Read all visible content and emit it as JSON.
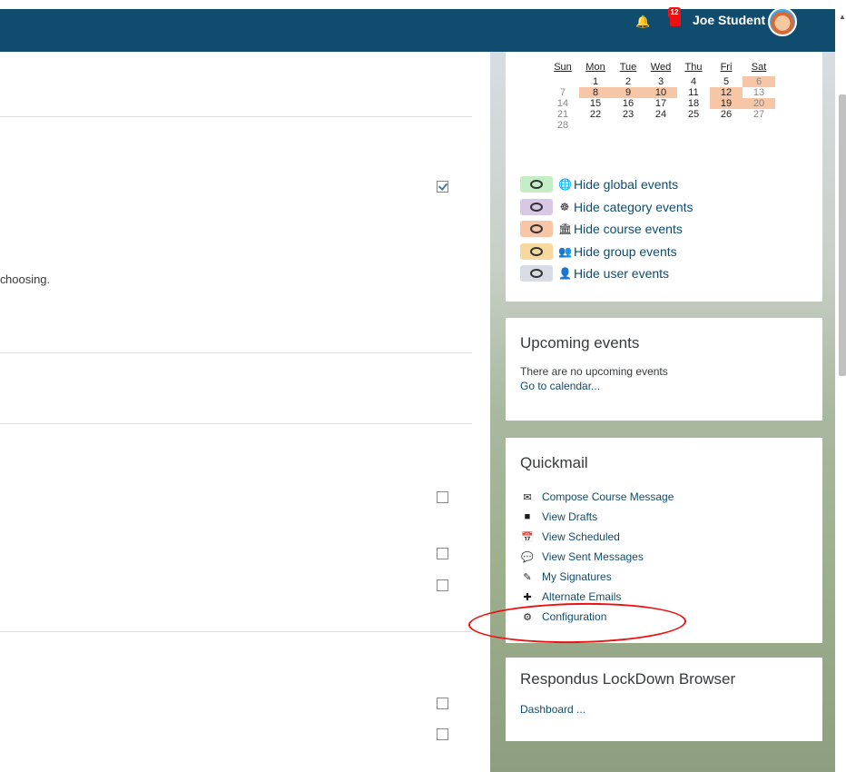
{
  "header": {
    "notification_count": "12",
    "user_name": "Joe Student"
  },
  "main": {
    "fragment_text": "hoosing."
  },
  "calendar": {
    "day_headers": [
      "Sun",
      "Mon",
      "Tue",
      "Wed",
      "Thu",
      "Fri",
      "Sat"
    ],
    "weeks": [
      [
        "",
        "1",
        "2",
        "3",
        "4",
        "5",
        "6"
      ],
      [
        "7",
        "8",
        "9",
        "10",
        "11",
        "12",
        "13"
      ],
      [
        "14",
        "15",
        "16",
        "17",
        "18",
        "19",
        "20"
      ],
      [
        "21",
        "22",
        "23",
        "24",
        "25",
        "26",
        "27"
      ],
      [
        "28",
        "",
        "",
        "",
        "",
        "",
        ""
      ]
    ],
    "legend": [
      {
        "label": "Hide global events",
        "icon": "globe-icon",
        "color": "#c6eec6"
      },
      {
        "label": "Hide category events",
        "icon": "cubes-icon",
        "color": "#d9c8e5"
      },
      {
        "label": "Hide course events",
        "icon": "university-icon",
        "color": "#f6c6a6"
      },
      {
        "label": "Hide group events",
        "icon": "users-icon",
        "color": "#f6d99e"
      },
      {
        "label": "Hide user events",
        "icon": "user-icon",
        "color": "#d6dde6"
      }
    ]
  },
  "upcoming": {
    "title": "Upcoming events",
    "empty_text": "There are no upcoming events",
    "link": "Go to calendar..."
  },
  "quickmail": {
    "title": "Quickmail",
    "items": [
      {
        "label": "Compose Course Message",
        "icon": "envelope-icon"
      },
      {
        "label": "View Drafts",
        "icon": "note-icon"
      },
      {
        "label": "View Scheduled",
        "icon": "calendar-check-icon"
      },
      {
        "label": "View Sent Messages",
        "icon": "comment-icon"
      },
      {
        "label": "My Signatures",
        "icon": "pencil-icon"
      },
      {
        "label": "Alternate Emails",
        "icon": "plus-icon"
      },
      {
        "label": "Configuration",
        "icon": "gear-icon"
      }
    ]
  },
  "respondus": {
    "title": "Respondus LockDown Browser",
    "link": "Dashboard ..."
  },
  "colors": {
    "navbar": "#0f4c6e",
    "event_highlight": "#f6c6a6",
    "annotation": "#e11111"
  }
}
